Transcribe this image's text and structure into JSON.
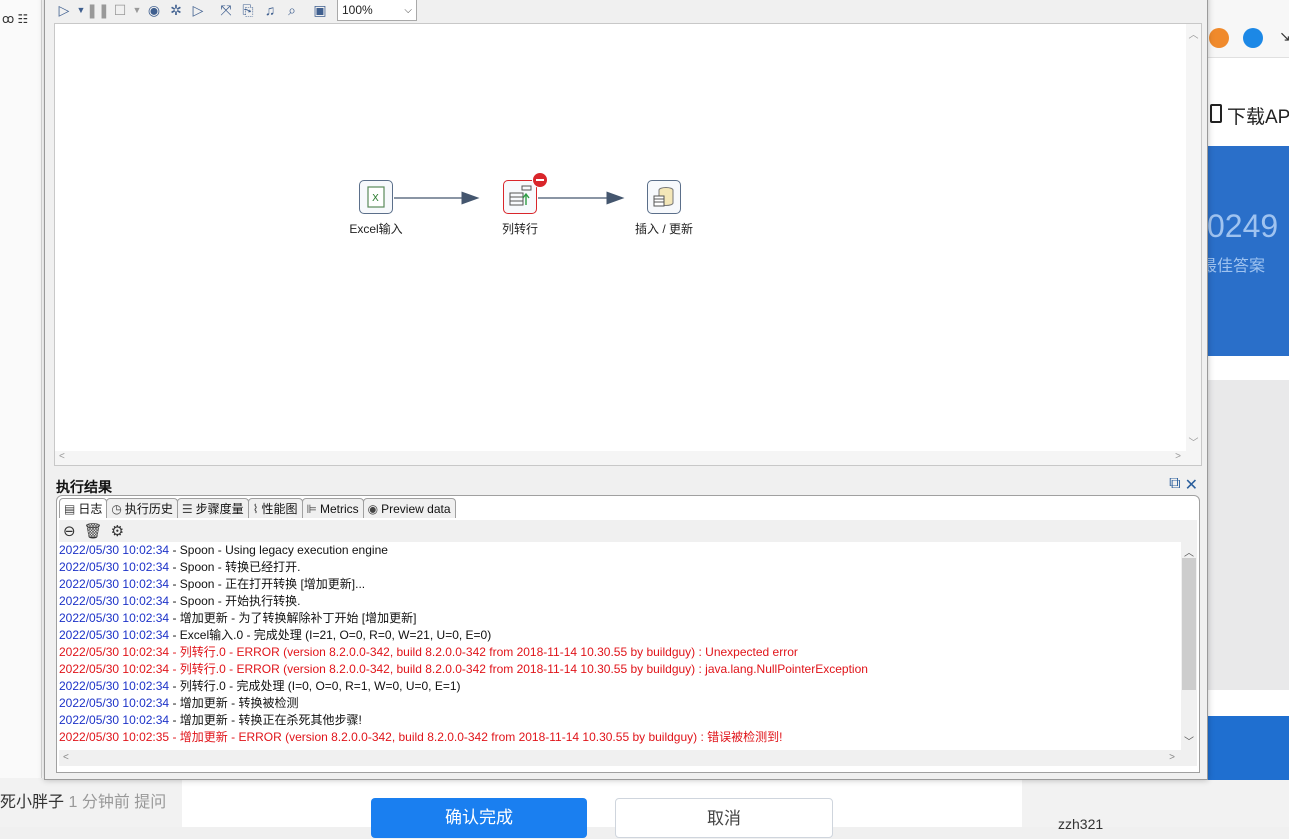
{
  "canvas": {
    "zoom": "100%",
    "steps": [
      {
        "label": "Excel输入"
      },
      {
        "label": "列转行"
      },
      {
        "label": "插入 / 更新"
      }
    ]
  },
  "results": {
    "title": "执行结果",
    "tabs": [
      "日志",
      "执行历史",
      "步骤度量",
      "性能图",
      "Metrics",
      "Preview data"
    ],
    "log": [
      {
        "ts": "2022/05/30 10:02:34",
        "msg": " - Spoon - Using legacy execution engine",
        "level": "info"
      },
      {
        "ts": "2022/05/30 10:02:34",
        "msg": " - Spoon - 转换已经打开.",
        "level": "info"
      },
      {
        "ts": "2022/05/30 10:02:34",
        "msg": " - Spoon - 正在打开转换 [增加更新]...",
        "level": "info"
      },
      {
        "ts": "2022/05/30 10:02:34",
        "msg": " - Spoon - 开始执行转换.",
        "level": "info"
      },
      {
        "ts": "2022/05/30 10:02:34",
        "msg": " - 增加更新 - 为了转换解除补丁开始  [增加更新]",
        "level": "info"
      },
      {
        "ts": "2022/05/30 10:02:34",
        "msg": " - Excel输入.0 - 完成处理 (I=21, O=0, R=0, W=21, U=0, E=0)",
        "level": "info"
      },
      {
        "ts": "2022/05/30 10:02:34",
        "msg": " - 列转行.0 - ERROR (version 8.2.0.0-342, build 8.2.0.0-342 from 2018-11-14 10.30.55 by buildguy) : Unexpected error",
        "level": "error"
      },
      {
        "ts": "2022/05/30 10:02:34",
        "msg": " - 列转行.0 - ERROR (version 8.2.0.0-342, build 8.2.0.0-342 from 2018-11-14 10.30.55 by buildguy) : java.lang.NullPointerException",
        "level": "error"
      },
      {
        "ts": "2022/05/30 10:02:34",
        "msg": " - 列转行.0 - 完成处理 (I=0, O=0, R=1, W=0, U=0, E=1)",
        "level": "info"
      },
      {
        "ts": "2022/05/30 10:02:34",
        "msg": " - 增加更新 - 转换被检测",
        "level": "info"
      },
      {
        "ts": "2022/05/30 10:02:34",
        "msg": " - 增加更新 - 转换正在杀死其他步骤!",
        "level": "info"
      },
      {
        "ts": "2022/05/30 10:02:35",
        "msg": " - 增加更新 - ERROR (version 8.2.0.0-342, build 8.2.0.0-342 from 2018-11-14 10.30.55 by buildguy) : 错误被检测到!",
        "level": "error"
      }
    ]
  },
  "background": {
    "download_app": "下载AP",
    "stat_number": "0249",
    "stat_sub": "最佳答案",
    "commenter": "死小胖子",
    "comment_time": "1 分钟前 提问",
    "confirm": "确认完成",
    "cancel": "取消",
    "corner_user": "zzh321"
  },
  "colors": {
    "log_timestamp": "#1c32c8",
    "log_error": "#e0141a",
    "accent_blue": "#1a7ff0",
    "error_badge": "#d9262b"
  }
}
